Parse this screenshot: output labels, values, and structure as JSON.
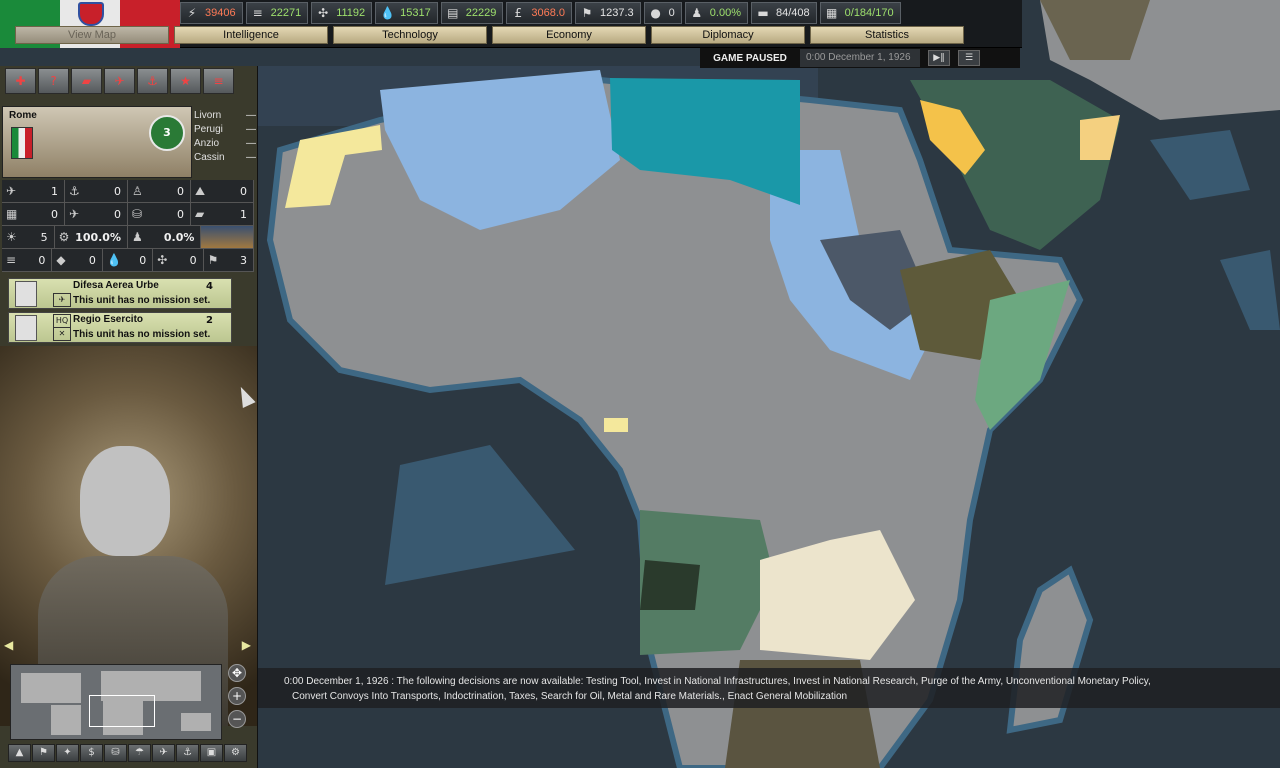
{
  "resources": [
    {
      "icon": "energy-icon",
      "glyph": "⚡",
      "value": "39406",
      "color": "red"
    },
    {
      "icon": "metal-icon",
      "glyph": "≡",
      "value": "22271",
      "color": "green"
    },
    {
      "icon": "rare-materials-icon",
      "glyph": "✣",
      "value": "11192",
      "color": "green"
    },
    {
      "icon": "oil-icon",
      "glyph": "💧",
      "value": "15317",
      "color": "green"
    },
    {
      "icon": "supplies-icon",
      "glyph": "▤",
      "value": "22229",
      "color": "green"
    },
    {
      "icon": "money-icon",
      "glyph": "£",
      "value": "3068.0",
      "color": "red"
    },
    {
      "icon": "manpower-icon",
      "glyph": "⚑",
      "value": "1237.3",
      "color": "white"
    },
    {
      "icon": "nuke-icon",
      "glyph": "●",
      "value": "0",
      "color": "white"
    },
    {
      "icon": "dissent-icon",
      "glyph": "♟",
      "value": "0.00%",
      "color": "green"
    },
    {
      "icon": "transports-icon",
      "glyph": "▬",
      "value": "84/408",
      "color": "white"
    },
    {
      "icon": "convoys-icon",
      "glyph": "▦",
      "value": "0/184/170",
      "color": "green"
    }
  ],
  "tabs": [
    {
      "label": "View Map",
      "disabled": true
    },
    {
      "label": "Intelligence"
    },
    {
      "label": "Technology"
    },
    {
      "label": "Economy"
    },
    {
      "label": "Diplomacy"
    },
    {
      "label": "Statistics"
    }
  ],
  "status": {
    "paused": "GAME PAUSED",
    "date": "0:00 December 1, 1926"
  },
  "province": {
    "name": "Rome",
    "badge": "3",
    "nearby": [
      "Livorn",
      "Perugi",
      "Anzio",
      "Cassin"
    ]
  },
  "stats_rows": [
    [
      {
        "icon": "✈",
        "v": "1"
      },
      {
        "icon": "⚓",
        "v": "0"
      },
      {
        "icon": "♙",
        "v": "0"
      },
      {
        "icon": "⛰",
        "v": "0"
      }
    ],
    [
      {
        "icon": "▦",
        "v": "0"
      },
      {
        "icon": "✈",
        "v": "0"
      },
      {
        "icon": "⛁",
        "v": "0"
      },
      {
        "icon": "▰",
        "v": "1"
      }
    ],
    [
      {
        "icon": "☀",
        "v": "5"
      },
      {
        "icon": "⚙",
        "v": "100.0%"
      },
      {
        "icon": "♟",
        "v": "0.0%"
      }
    ],
    [
      {
        "icon": "≡",
        "v": "0"
      },
      {
        "icon": "◆",
        "v": "0"
      },
      {
        "icon": "💧",
        "v": "0"
      },
      {
        "icon": "✣",
        "v": "0"
      },
      {
        "icon": "⚑",
        "v": "3"
      }
    ]
  ],
  "units": [
    {
      "name": "Difesa Aerea Urbe",
      "count": "4",
      "mission": "This unit has no mission set."
    },
    {
      "name": "Regio Esercito",
      "count": "2",
      "mission": "This unit has no mission set.",
      "type_label": "HQ"
    }
  ],
  "messages": {
    "line1": "0:00 December 1, 1926 : The following decisions are now available: Testing Tool, Invest in National Infrastructures, Invest in National Research, Purge of the Army, Unconventional Monetary Policy,",
    "line2": "Convert Convoys Into Transports, Indoctrination, Taxes, Search for Oil, Metal and Rare Materials., Enact General Mobilization"
  },
  "colors": {
    "ocean": "#2c3842",
    "coast": "#3e6884",
    "neutral_land": "#8e9092",
    "france_blue": "#8cb4e0",
    "italy_teal": "#1a98a8",
    "spain_yellow": "#f4e89c",
    "portugal_green": "#547c64",
    "britain_dark": "#3c4a58"
  }
}
